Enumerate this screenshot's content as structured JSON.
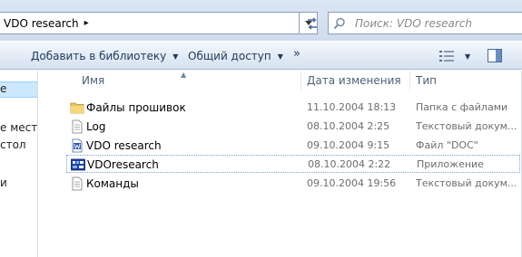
{
  "address_bar": {
    "path_segments": [
      "VDO research"
    ],
    "separator": "▸"
  },
  "search": {
    "placeholder": "Поиск: VDO research"
  },
  "toolbar": {
    "add_to_library_label": "Добавить в библиотеку",
    "share_label": "Общий доступ",
    "more_label": "»"
  },
  "nav_pane": {
    "items": [
      {
        "label": "е",
        "selected": true
      },
      {
        "label": "е места",
        "selected": false
      },
      {
        "label": "стол",
        "selected": false
      },
      {
        "label": "и",
        "selected": false
      }
    ]
  },
  "columns": {
    "name": "Имя",
    "date": "Дата изменения",
    "type": "Тип"
  },
  "files": [
    {
      "name": "Файлы прошивок",
      "date": "11.10.2004 18:13",
      "type": "Папка с файлами",
      "icon": "folder-icon"
    },
    {
      "name": "Log",
      "date": "08.10.2004 2:25",
      "type": "Текстовый докум...",
      "icon": "text-file-icon"
    },
    {
      "name": "VDO research",
      "date": "09.10.2004 9:15",
      "type": "Файл \"DOC\"",
      "icon": "word-doc-icon"
    },
    {
      "name": "VDOresearch",
      "date": "08.10.2004 2:22",
      "type": "Приложение",
      "icon": "app-icon"
    },
    {
      "name": "Команды",
      "date": "09.10.2004 19:56",
      "type": "Текстовый докум...",
      "icon": "text-file-icon"
    }
  ],
  "colors": {
    "accent": "#1e395b",
    "selection": "#cce8ff",
    "secondary_text": "#6d6d6d"
  }
}
